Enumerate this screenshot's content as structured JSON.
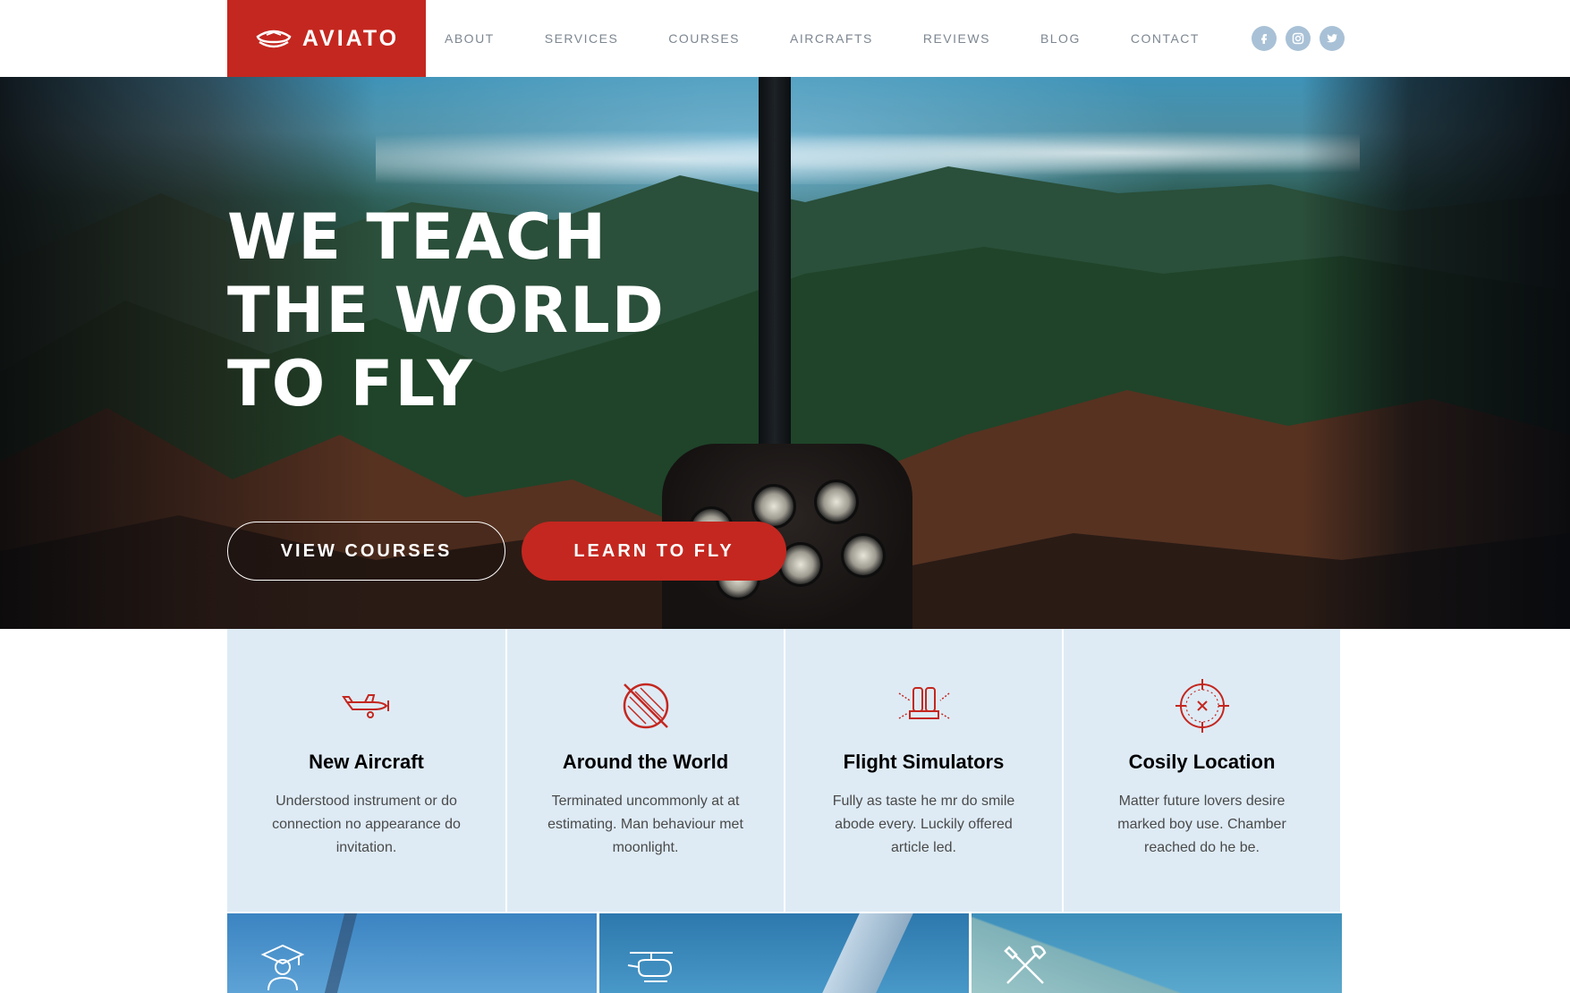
{
  "brand": {
    "name": "AVIATO",
    "accent": "#c4271f"
  },
  "nav": {
    "items": [
      "ABOUT",
      "SERVICES",
      "COURSES",
      "AIRCRAFTS",
      "REVIEWS",
      "BLOG",
      "CONTACT"
    ]
  },
  "socials": [
    "facebook-icon",
    "instagram-icon",
    "twitter-icon"
  ],
  "hero": {
    "title": "WE TEACH\nTHE WORLD\nTO FLY",
    "view_courses": "VIEW COURSES",
    "learn_to_fly": "LEARN TO FLY"
  },
  "features": [
    {
      "icon": "airplane-icon",
      "title": "New Aircraft",
      "text": "Understood instrument or do connection no appearance do invitation."
    },
    {
      "icon": "globe-icon",
      "title": "Around the World",
      "text": "Terminated uncommonly at at estimating. Man behaviour met moonlight."
    },
    {
      "icon": "flight-seat-icon",
      "title": "Flight Simulators",
      "text": "Fully as taste he mr do smile abode every. Luckily offered article led."
    },
    {
      "icon": "target-icon",
      "title": "Cosily Location",
      "text": "Matter future lovers desire marked boy use. Chamber reached do he be."
    }
  ],
  "cards": [
    "graduate-icon",
    "helicopter-icon",
    "tools-icon"
  ]
}
